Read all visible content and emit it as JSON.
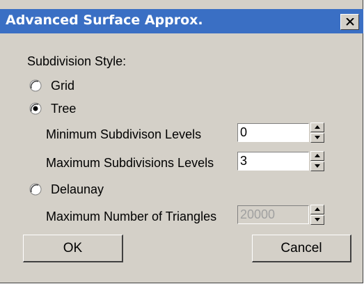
{
  "dialog": {
    "title": "Advanced Surface Approx.",
    "close_icon": "close-x-icon"
  },
  "subdivision": {
    "label": "Subdivision Style:",
    "options": [
      {
        "label": "Grid",
        "selected": false
      },
      {
        "label": "Tree",
        "selected": true
      },
      {
        "label": "Delaunay",
        "selected": false
      }
    ]
  },
  "tree_settings": {
    "min_label": "Minimum Subdivison Levels",
    "min_value": "0",
    "max_label": "Maximum Subdivisions Levels",
    "max_value": "3"
  },
  "delaunay_settings": {
    "max_triangles_label": "Maximum Number of Triangles",
    "max_triangles_value": "20000",
    "enabled": false
  },
  "buttons": {
    "ok": "OK",
    "cancel": "Cancel"
  },
  "colors": {
    "titlebar": "#3a6fc4",
    "window_bg": "#d4d0c8"
  }
}
